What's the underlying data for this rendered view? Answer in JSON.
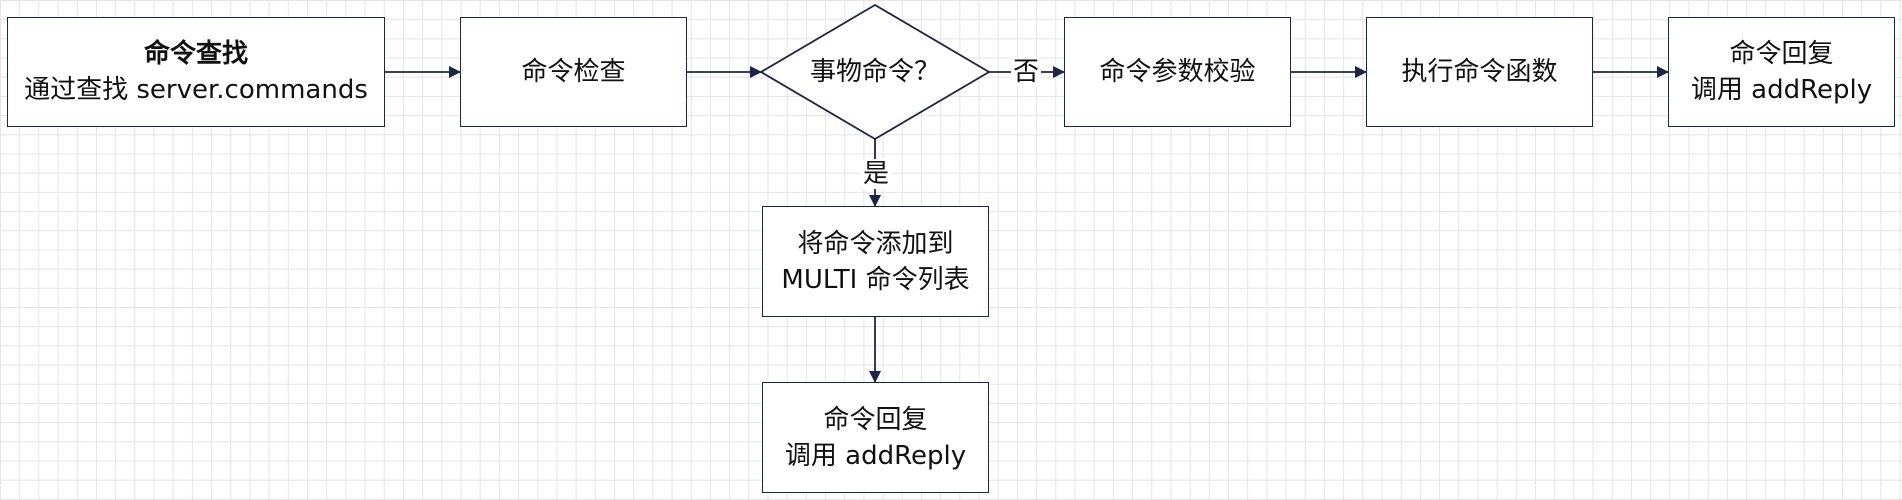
{
  "nodes": {
    "lookup": {
      "title": "命令查找",
      "subtitle": "通过查找 server.commands"
    },
    "check": {
      "label": "命令检查"
    },
    "decision": {
      "label": "事物命令？"
    },
    "validate": {
      "label": "命令参数校验"
    },
    "execute": {
      "label": "执行命令函数"
    },
    "reply_main": {
      "line1": "命令回复",
      "line2": "调用 addReply"
    },
    "queue": {
      "line1": "将命令添加到",
      "line2": "MULTI 命令列表"
    },
    "reply_queue": {
      "line1": "命令回复",
      "line2": "调用 addReply"
    }
  },
  "edges": {
    "no_label": "否",
    "yes_label": "是"
  },
  "colors": {
    "stroke": "#1d2545",
    "grid": "#e4e4e4",
    "fill": "#ffffff"
  }
}
